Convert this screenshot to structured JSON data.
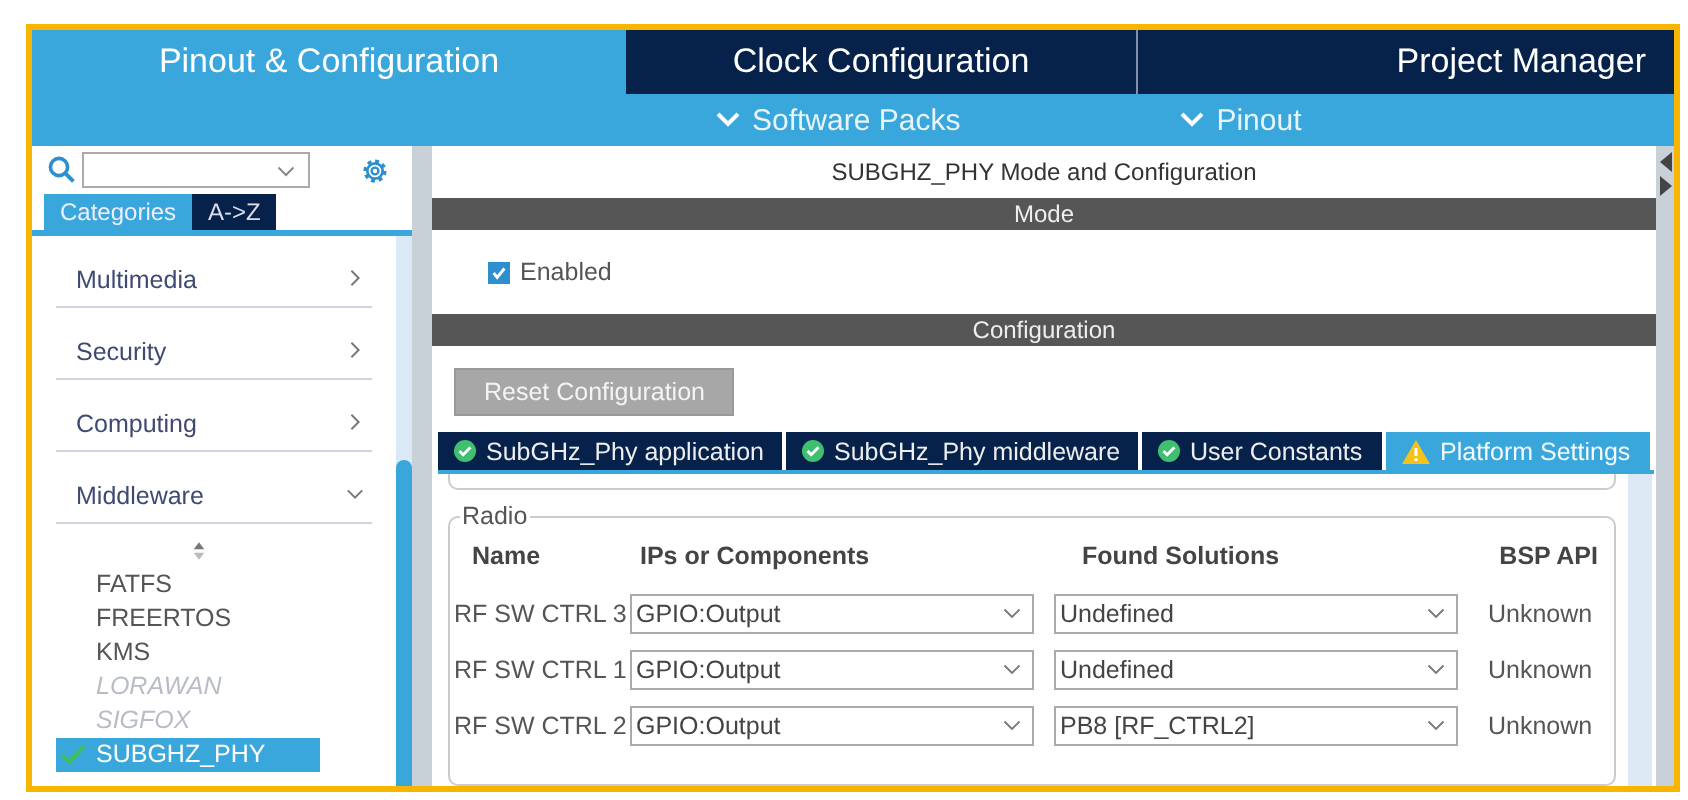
{
  "main_tabs": [
    {
      "label": "Pinout & Configuration",
      "selected": true
    },
    {
      "label": "Clock Configuration",
      "selected": false
    },
    {
      "label": "Project Manager",
      "selected": false
    }
  ],
  "sub_menu": [
    {
      "label": "Software Packs"
    },
    {
      "label": "Pinout"
    }
  ],
  "sidebar": {
    "view_tabs": [
      {
        "label": "Categories",
        "selected": true
      },
      {
        "label": "A->Z",
        "selected": false
      }
    ],
    "categories": [
      {
        "label": "Multimedia",
        "expanded": false
      },
      {
        "label": "Security",
        "expanded": false
      },
      {
        "label": "Computing",
        "expanded": false
      },
      {
        "label": "Middleware",
        "expanded": true,
        "children": [
          {
            "label": "FATFS",
            "disabled": false,
            "selected": false,
            "checked": false
          },
          {
            "label": "FREERTOS",
            "disabled": false,
            "selected": false,
            "checked": false
          },
          {
            "label": "KMS",
            "disabled": false,
            "selected": false,
            "checked": false
          },
          {
            "label": "LORAWAN",
            "disabled": true,
            "selected": false,
            "checked": false
          },
          {
            "label": "SIGFOX",
            "disabled": true,
            "selected": false,
            "checked": false
          },
          {
            "label": "SUBGHZ_PHY",
            "disabled": false,
            "selected": true,
            "checked": true
          }
        ]
      }
    ]
  },
  "panel": {
    "title": "SUBGHZ_PHY Mode and Configuration",
    "mode": {
      "header": "Mode",
      "enabled": {
        "label": "Enabled",
        "checked": true
      }
    },
    "configuration": {
      "header": "Configuration",
      "reset_button": "Reset Configuration",
      "tabs": [
        {
          "label": "SubGHz_Phy application",
          "kind": "ok",
          "selected": false
        },
        {
          "label": "SubGHz_Phy middleware",
          "kind": "ok",
          "selected": false
        },
        {
          "label": "User Constants",
          "kind": "ok",
          "selected": false
        },
        {
          "label": "Platform Settings",
          "kind": "warning",
          "selected": true
        }
      ],
      "radio": {
        "legend": "Radio",
        "columns": [
          "Name",
          "IPs or Components",
          "Found Solutions",
          "BSP API"
        ],
        "rows": [
          {
            "name": "RF SW CTRL 3",
            "ip": "GPIO:Output",
            "solution": "Undefined",
            "bsp_api": "Unknown"
          },
          {
            "name": "RF SW CTRL 1",
            "ip": "GPIO:Output",
            "solution": "Undefined",
            "bsp_api": "Unknown"
          },
          {
            "name": "RF SW CTRL 2",
            "ip": "GPIO:Output",
            "solution": "PB8 [RF_CTRL2]",
            "bsp_api": "Unknown"
          }
        ]
      }
    }
  }
}
